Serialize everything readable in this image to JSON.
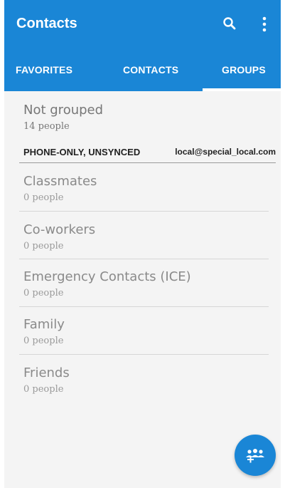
{
  "app_bar": {
    "title": "Contacts",
    "search_icon": "search-icon",
    "menu_icon": "more-vert-icon",
    "color": "#1a86d6"
  },
  "tabs": [
    {
      "label": "FAVORITES",
      "selected": false
    },
    {
      "label": "CONTACTS",
      "selected": false
    },
    {
      "label": "GROUPS",
      "selected": true
    }
  ],
  "ungrouped": {
    "name": "Not grouped",
    "count": "14 people"
  },
  "account": {
    "type": "PHONE-ONLY, UNSYNCED",
    "name": "local@special_local.com"
  },
  "groups": [
    {
      "name": "Classmates",
      "count": "0 people"
    },
    {
      "name": "Co-workers",
      "count": "0 people"
    },
    {
      "name": "Emergency Contacts (ICE)",
      "count": "0 people"
    },
    {
      "name": "Family",
      "count": "0 people"
    },
    {
      "name": "Friends",
      "count": "0 people"
    }
  ],
  "fab": {
    "icon": "add-group-icon"
  }
}
